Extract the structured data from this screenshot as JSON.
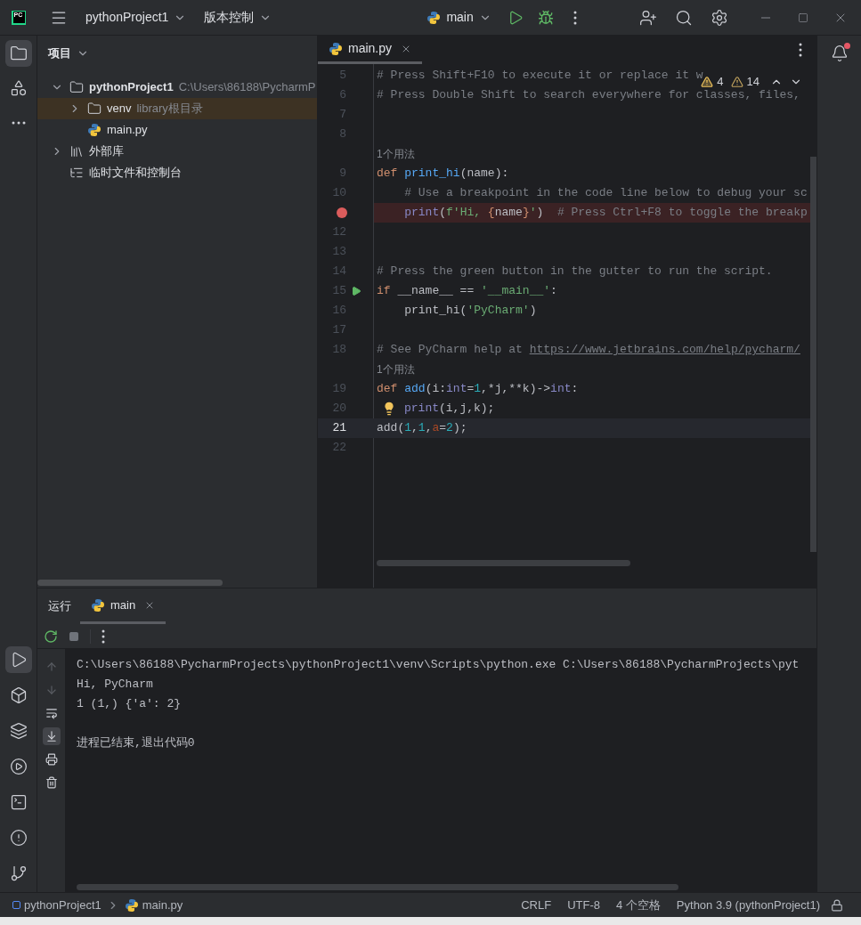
{
  "titlebar": {
    "logo": "PC",
    "project": "pythonProject1",
    "vcs": "版本控制",
    "run_config": "main"
  },
  "left_toolbar": {
    "top": [
      {
        "kind": "folder",
        "selected": true
      },
      {
        "kind": "structure",
        "selected": false
      },
      {
        "kind": "more",
        "selected": false
      }
    ],
    "bottom": [
      {
        "kind": "run",
        "selected": true
      },
      {
        "kind": "python",
        "selected": false
      },
      {
        "kind": "layers",
        "selected": false
      },
      {
        "kind": "services",
        "selected": false
      },
      {
        "kind": "terminal",
        "selected": false
      },
      {
        "kind": "problems",
        "selected": false
      },
      {
        "kind": "git",
        "selected": false
      }
    ]
  },
  "project": {
    "title": "项目",
    "tree": [
      {
        "label": "pythonProject1",
        "note": "C:\\Users\\86188\\PycharmP",
        "kind": "folder",
        "expanded": true,
        "selected": false,
        "children": [
          {
            "label": "venv",
            "note": "library根目录",
            "kind": "folder",
            "expanded": false,
            "selected": true
          },
          {
            "label": "main.py",
            "kind": "python",
            "selected": false
          }
        ]
      },
      {
        "label": "外部库",
        "kind": "library",
        "expanded": false,
        "selected": false
      },
      {
        "label": "临时文件和控制台",
        "kind": "scratch",
        "selected": false
      }
    ]
  },
  "editor": {
    "tabs": [
      {
        "label": "main.py",
        "selected": true
      }
    ],
    "warnings": [
      {
        "kind": "warning",
        "count": "4"
      },
      {
        "kind": "weak",
        "count": "14"
      }
    ],
    "lines": [
      {
        "kind": "code",
        "number": "5",
        "current": false,
        "segments": [
          {
            "kind": "comment",
            "text": "# Press Shift+F10 to execute it or replace it w"
          }
        ]
      },
      {
        "kind": "code",
        "number": "6",
        "current": false,
        "segments": [
          {
            "kind": "comment",
            "text": "# Press Double Shift to search everywhere for classes, files,"
          }
        ]
      },
      {
        "kind": "code",
        "number": "7",
        "current": false
      },
      {
        "kind": "code",
        "number": "8",
        "current": false
      },
      {
        "kind": "hint",
        "text": "1个用法"
      },
      {
        "kind": "code",
        "number": "9",
        "current": false,
        "segments": [
          {
            "kind": "keyword",
            "text": "def "
          },
          {
            "kind": "function",
            "text": "print_hi"
          },
          {
            "kind": "plain",
            "text": "(name):"
          }
        ]
      },
      {
        "kind": "code",
        "number": "10",
        "current": false,
        "segments": [
          {
            "kind": "comment",
            "text": "    # Use a breakpoint in the code line below to debug your sc"
          }
        ]
      },
      {
        "kind": "breakpoint",
        "current": false,
        "segments": [
          {
            "kind": "builtin",
            "text": "    print"
          },
          {
            "kind": "plain",
            "text": "("
          },
          {
            "kind": "string",
            "text": "f'Hi, "
          },
          {
            "kind": "keyword",
            "text": "{"
          },
          {
            "kind": "plain",
            "text": "name"
          },
          {
            "kind": "keyword",
            "text": "}"
          },
          {
            "kind": "string",
            "text": "'"
          },
          {
            "kind": "plain",
            "text": ")  "
          },
          {
            "kind": "comment",
            "text": "# Press Ctrl+F8 to toggle the breakp"
          }
        ]
      },
      {
        "kind": "code",
        "number": "12",
        "current": false
      },
      {
        "kind": "code",
        "number": "13",
        "current": false
      },
      {
        "kind": "code",
        "number": "14",
        "current": false,
        "segments": [
          {
            "kind": "comment",
            "text": "# Press the green button in the gutter to run the script."
          }
        ]
      },
      {
        "kind": "run",
        "number": "15",
        "current": false,
        "segments": [
          {
            "kind": "keyword",
            "text": "if "
          },
          {
            "kind": "plain",
            "text": "__name__ == "
          },
          {
            "kind": "string",
            "text": "'__main__'"
          },
          {
            "kind": "plain",
            "text": ":"
          }
        ]
      },
      {
        "kind": "code",
        "number": "16",
        "current": false,
        "segments": [
          {
            "kind": "plain",
            "text": "    print_hi("
          },
          {
            "kind": "string",
            "text": "'PyCharm'"
          },
          {
            "kind": "plain",
            "text": ")"
          }
        ]
      },
      {
        "kind": "code",
        "number": "17",
        "current": false
      },
      {
        "kind": "code",
        "number": "18",
        "current": false,
        "segments": [
          {
            "kind": "comment",
            "text": "# See PyCharm help at "
          },
          {
            "kind": "link",
            "text": "https://www.jetbrains.com/help/pycharm/"
          }
        ]
      },
      {
        "kind": "hint",
        "text": "1个用法"
      },
      {
        "kind": "code",
        "number": "19",
        "current": false,
        "segments": [
          {
            "kind": "keyword",
            "text": "def "
          },
          {
            "kind": "function",
            "text": "add"
          },
          {
            "kind": "plain",
            "text": "(i:"
          },
          {
            "kind": "builtin",
            "text": "int"
          },
          {
            "kind": "plain",
            "text": "="
          },
          {
            "kind": "number",
            "text": "1"
          },
          {
            "kind": "plain",
            "text": ",*j,**k)->"
          },
          {
            "kind": "builtin",
            "text": "int"
          },
          {
            "kind": "plain",
            "text": ":"
          }
        ]
      },
      {
        "kind": "bulb",
        "number": "20",
        "current": false,
        "segments": [
          {
            "kind": "builtin",
            "text": "print"
          },
          {
            "kind": "plain",
            "text": "(i,j,k);"
          }
        ]
      },
      {
        "kind": "code",
        "number": "21",
        "current": true,
        "segments": [
          {
            "kind": "plain",
            "text": "add("
          },
          {
            "kind": "number",
            "text": "1"
          },
          {
            "kind": "plain",
            "text": ","
          },
          {
            "kind": "number",
            "text": "1"
          },
          {
            "kind": "plain",
            "text": ","
          },
          {
            "kind": "param",
            "text": "a"
          },
          {
            "kind": "plain",
            "text": "="
          },
          {
            "kind": "number",
            "text": "2"
          },
          {
            "kind": "plain",
            "text": ");"
          }
        ]
      },
      {
        "kind": "code",
        "number": "22",
        "current": false
      }
    ]
  },
  "run_panel": {
    "title": "运行",
    "tabs": [
      {
        "label": "main",
        "selected": true
      }
    ],
    "side_tools": [
      {
        "kind": "up",
        "selected": false
      },
      {
        "kind": "down",
        "selected": false
      },
      {
        "kind": "wrap",
        "selected": false
      },
      {
        "kind": "scroll",
        "selected": true
      },
      {
        "kind": "print",
        "selected": false
      },
      {
        "kind": "trash",
        "selected": false
      }
    ],
    "output": [
      {
        "kind": "text",
        "text": "C:\\Users\\86188\\PycharmProjects\\pythonProject1\\venv\\Scripts\\python.exe C:\\Users\\86188\\PycharmProjects\\pyt"
      },
      {
        "kind": "text",
        "text": "Hi, PyCharm"
      },
      {
        "kind": "text",
        "text": "1 (1,) {'a': 2}"
      },
      {
        "kind": "exit",
        "text": "进程已结束,退出代码0"
      }
    ]
  },
  "status_bar": {
    "breadcrumbs": [
      {
        "kind": "module",
        "label": "pythonProject1"
      },
      {
        "kind": "python",
        "label": "main.py"
      }
    ],
    "items": [
      "CRLF",
      "UTF-8",
      "4 个空格",
      "Python 3.9 (pythonProject1)"
    ]
  }
}
